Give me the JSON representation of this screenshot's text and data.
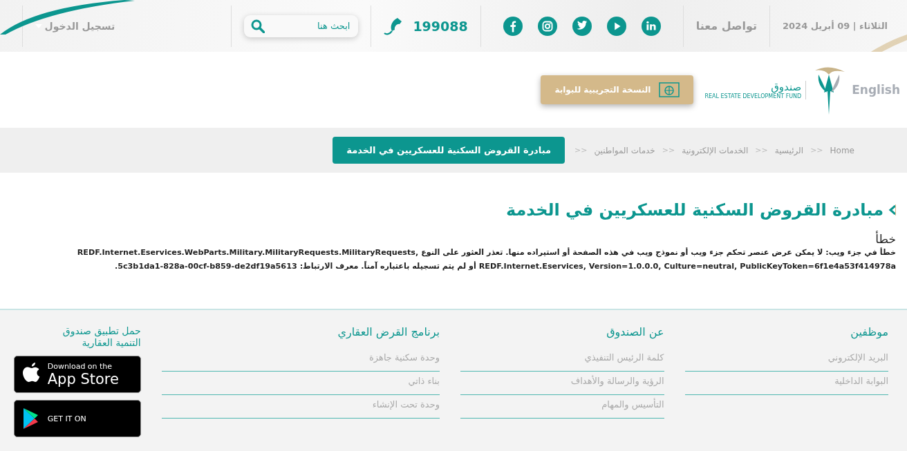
{
  "top_bar": {
    "date": "الثلاثاء | 09 أبريل 2024",
    "contact_label": "تواصل معنا",
    "social": [
      {
        "kind": "linkedin"
      },
      {
        "kind": "youtube"
      },
      {
        "kind": "twitter"
      },
      {
        "kind": "instagram"
      },
      {
        "kind": "facebook"
      }
    ],
    "phone": "199088",
    "search": {
      "placeholder": "ابحث هنا"
    },
    "login": "تسجيل الدخول"
  },
  "header": {
    "logo_arabic": "صندوق",
    "logo_english": "REAL ESTATE DEVELOPMENT FUND",
    "language_link": "English",
    "beta_banner": "النسخة التجريبية للبوابة"
  },
  "breadcrumb": [
    {
      "kind": "link",
      "label": "Home"
    },
    {
      "kind": "separator",
      "label": ">>"
    },
    {
      "kind": "link",
      "label": "الرئيسية"
    },
    {
      "kind": "separator",
      "label": ">>"
    },
    {
      "kind": "link",
      "label": "الخدمات الإلكترونية"
    },
    {
      "kind": "separator",
      "label": ">>"
    },
    {
      "kind": "link",
      "label": "خدمات المواطنين"
    },
    {
      "kind": "separator",
      "label": ">>"
    },
    {
      "kind": "current",
      "label": "مبادرة القروض السكنية للعسكريين في الخدمة"
    }
  ],
  "page": {
    "title": "مبادرة القروض السكنية للعسكريين في الخدمة",
    "error_heading": "خطأ",
    "error_message": "خطأ في جزء ويب: لا يمكن عرض عنصر تحكم جزء ويب أو نموذج ويب في هذه الصفحة أو استيراده منها. تعذر العثور على النوع REDF.Internet.Eservices.WebParts.Military.MilitaryRequests.MilitaryRequests, REDF.Internet.Eservices, Version=1.0.0.0, Culture=neutral, PublicKeyToken=6f1e4a53f414978a أو لم يتم تسجيله باعتباره آمناً. معرف الارتباط: 5c3b1da1-828a-00cf-b859-de2df19a5613."
  },
  "footer": {
    "columns": [
      {
        "heading": "موظفين",
        "links": [
          "البريد الإلكتروني",
          "البوابة الداخلية"
        ]
      },
      {
        "heading": "عن الصندوق",
        "links": [
          "كلمة الرئيس التنفيذي",
          "الرؤية والرسالة والأهداف",
          "التأسيس والمهام"
        ]
      },
      {
        "heading": "برنامج القرض العقاري",
        "links": [
          "وحدة سكنية جاهزة",
          "بناء ذاتي",
          "وحدة تحت الإنشاء"
        ]
      }
    ],
    "app": {
      "heading": "حمل تطبيق صندوق التنمية العقارية",
      "badges": [
        {
          "kind": "apple",
          "small": "Download on the",
          "large": "App Store"
        },
        {
          "kind": "google",
          "small": "GET IT ON"
        }
      ]
    }
  }
}
